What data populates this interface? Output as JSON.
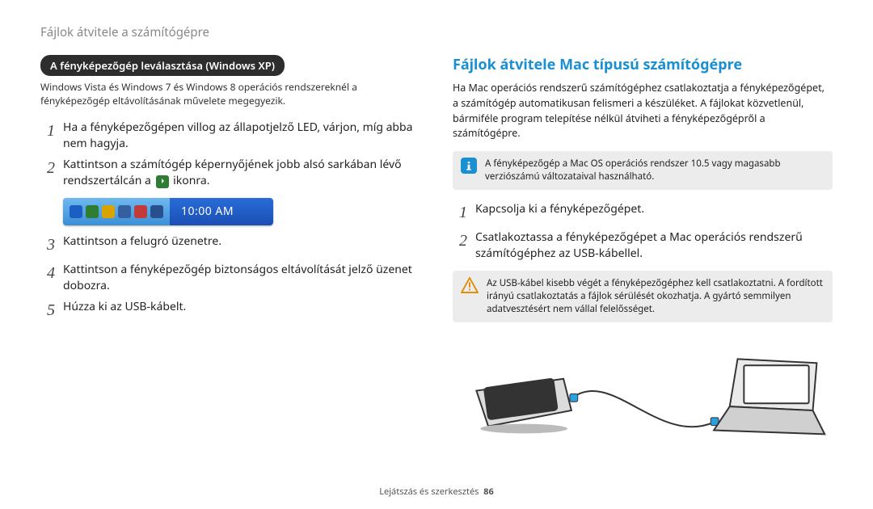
{
  "breadcrumb": "Fájlok átvitele a számítógépre",
  "left": {
    "pill": "A fényképezőgép leválasztása (Windows XP)",
    "note": "Windows Vista és Windows 7 és Windows 8 operációs rendszereknél a fényképezőgép eltávolításának művelete megegyezik.",
    "steps_a": [
      "Ha a fényképezőgépen villog az állapotjelző LED, várjon, míg abba nem hagyja.",
      "Kattintson a számítógép képernyőjének jobb alsó sarkában lévő rendszertálcán a "
    ],
    "step2_suffix": " ikonra.",
    "taskbar": {
      "clock": "10:00 AM",
      "icons": [
        "arrow",
        "device",
        "shield",
        "monitor",
        "volume",
        "network"
      ]
    },
    "steps_b": [
      "Kattintson a felugró üzenetre.",
      "Kattintson a fényképezőgép biztonságos eltávolítását jelző üzenet dobozra.",
      "Húzza ki az USB-kábelt."
    ]
  },
  "right": {
    "heading": "Fájlok átvitele Mac típusú számítógépre",
    "para": "Ha Mac operációs rendszerű számítógéphez csatlakoztatja a fényképezőgépet, a számítógép automatikusan felismeri a készüléket. A fájlokat közvetlenül, bármiféle program telepítése nélkül átviheti a fényképezőgépről a számítógépre.",
    "info": "A fényképezőgép a Mac OS operációs rendszer 10.5 vagy magasabb verziószámú változataival használható.",
    "steps": [
      "Kapcsolja ki a fényképezőgépet.",
      "Csatlakoztassa a fényképezőgépet a Mac operációs rendszerű számítógéphez az USB-kábellel."
    ],
    "warn": "Az USB-kábel kisebb végét a fényképezőgéphez kell csatlakoztatni. A fordított irányú csatlakoztatás a fájlok sérülését okozhatja. A gyártó semmilyen adatvesztésért nem vállal felelősséget."
  },
  "footer": {
    "section": "Lejátszás és szerkesztés",
    "page": "86"
  }
}
